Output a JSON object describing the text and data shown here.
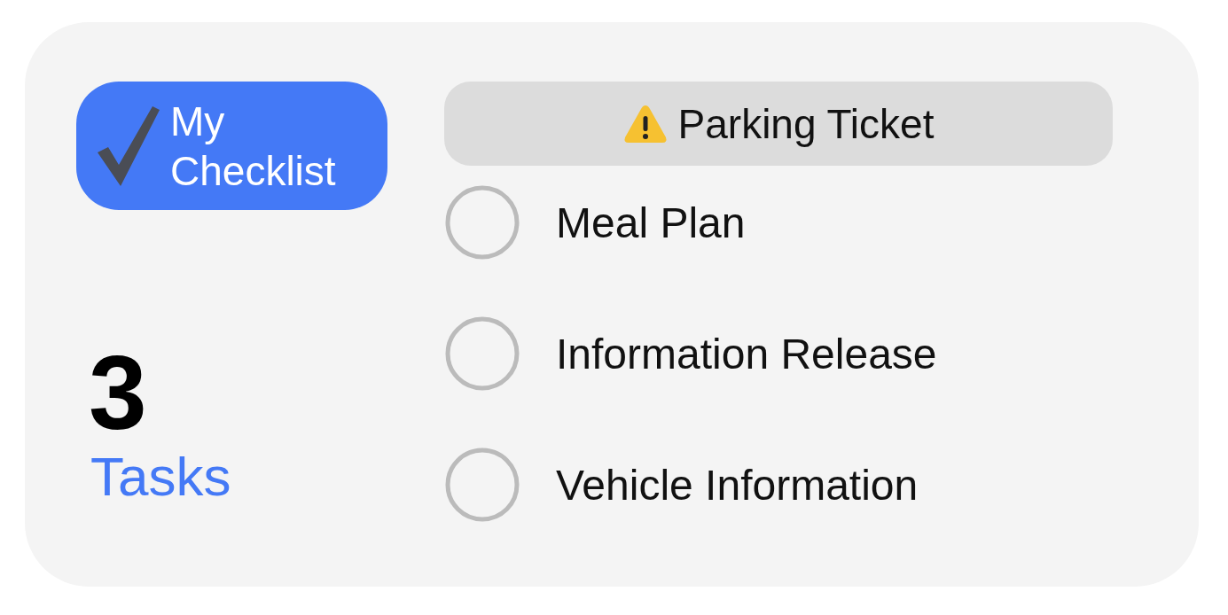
{
  "badge": {
    "title": "My Checklist"
  },
  "count": "3",
  "count_label": "Tasks",
  "header": {
    "title": "Parking Ticket"
  },
  "items": [
    {
      "label": "Meal Plan",
      "checked": false
    },
    {
      "label": "Information Release",
      "checked": false
    },
    {
      "label": "Vehicle Information",
      "checked": false
    }
  ]
}
